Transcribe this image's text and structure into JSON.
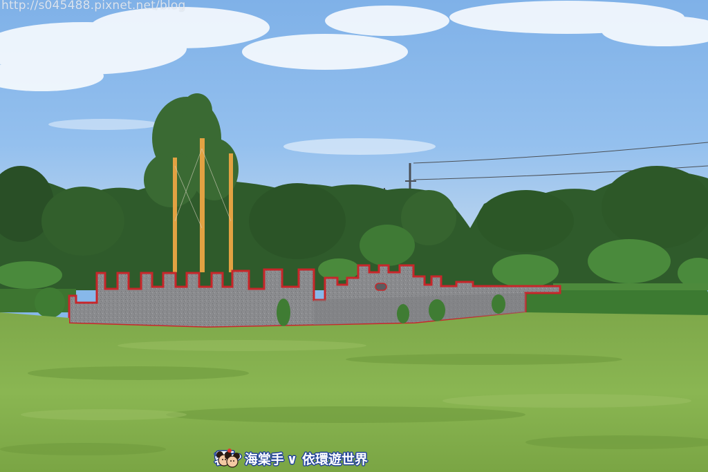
{
  "photo": {
    "subject": "park-fort-ship-replica",
    "colors": {
      "sky_top": "#7eb2ea",
      "sky_bottom": "#b9d4ef",
      "grass": "#86b24e",
      "grass_dark": "#6c9a3c",
      "trees": "#2f5a2a",
      "wall": "#8d8d8f",
      "wall_trim": "#c8262a",
      "mast": "#e3a243",
      "hedge": "#3f7a32"
    }
  },
  "watermarks": {
    "url": "http://s045488.pixnet.net/blog",
    "signature_part1": "蓉",
    "signature_heart": "❤",
    "signature_part2": "海棠手",
    "signature_part3": "∨ 依環遊世界"
  },
  "icons": {
    "heart": "heart-icon",
    "hand": "pointing-hand-icon",
    "mascot": "mouse-couple-icon"
  }
}
